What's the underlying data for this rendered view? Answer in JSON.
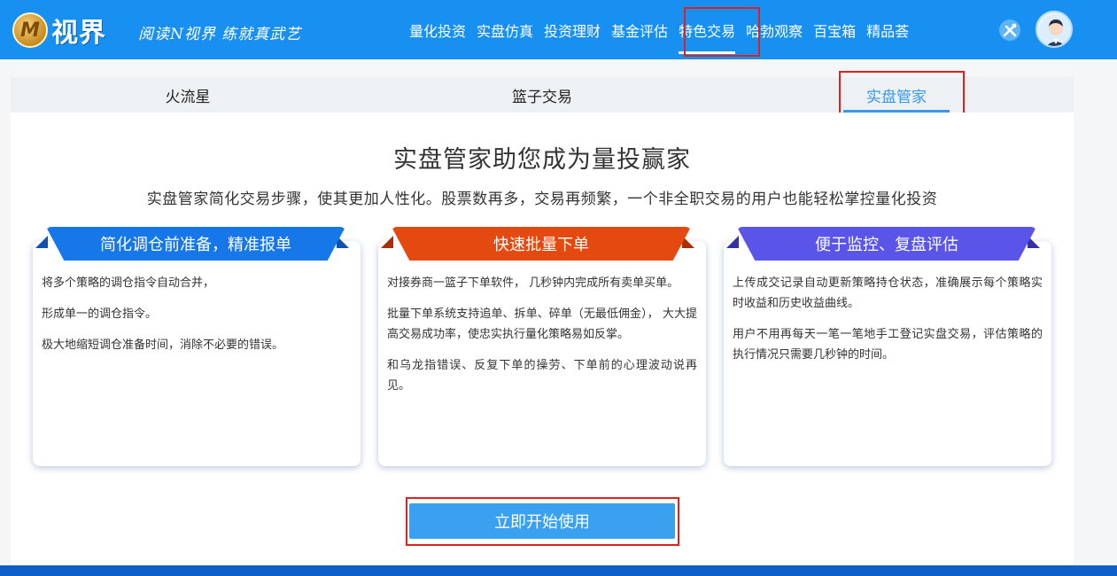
{
  "header": {
    "logo_text": "视界",
    "logo_mark": "M",
    "slogan": "阅读N视界 练就真武艺",
    "nav": [
      {
        "label": "量化投资"
      },
      {
        "label": "实盘仿真"
      },
      {
        "label": "投资理财"
      },
      {
        "label": "基金评估"
      },
      {
        "label": "特色交易",
        "active": true
      },
      {
        "label": "哈勃观察"
      },
      {
        "label": "百宝箱"
      },
      {
        "label": "精品荟"
      }
    ],
    "tool_icon": "tools-icon",
    "avatar_icon": "user-avatar"
  },
  "tabs": [
    {
      "label": "火流星"
    },
    {
      "label": "篮子交易"
    },
    {
      "label": "实盘管家",
      "active": true
    }
  ],
  "main": {
    "headline": "实盘管家助您成为量投赢家",
    "subline": "实盘管家简化交易步骤，使其更加人性化。股票数再多，交易再频繁，一个非全职交易的用户也能轻松掌控量化投资",
    "cards": [
      {
        "title": "简化调仓前准备，精准报单",
        "color": "#1677e8",
        "paragraphs": [
          "将多个策略的调仓指令自动合并，",
          "形成单一的调仓指令。",
          "极大地缩短调仓准备时间，消除不必要的错误。"
        ]
      },
      {
        "title": "快速批量下单",
        "color": "#e44a10",
        "paragraphs": [
          "对接券商一篮子下单软件， 几秒钟内完成所有卖单买单。",
          "批量下单系统支持追单、拆单、碎单（无最低佣金）， 大大提高交易成功率，使忠实执行量化策略易如反掌。",
          "和乌龙指错误、反复下单的操劳、下单前的心理波动说再见。"
        ]
      },
      {
        "title": "便于监控、复盘评估",
        "color": "#5a55e8",
        "paragraphs": [
          "上传成交记录自动更新策略持仓状态，准确展示每个策略实时收益和历史收益曲线。",
          "用户不用再每天一笔一笔地手工登记实盘交易，评估策略的执行情况只需要几秒钟的时间。"
        ]
      }
    ],
    "start_button": "立即开始使用"
  },
  "colors": {
    "header_bg": "#1890f2",
    "accent": "#3a98e8",
    "highlight": "#e0201e",
    "footer": "#0e5fc8"
  }
}
